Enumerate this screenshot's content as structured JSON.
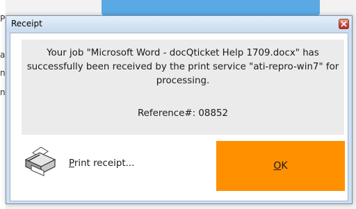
{
  "window": {
    "title": "Receipt"
  },
  "message": {
    "body": "Your job \"Microsoft Word - docQticket Help 1709.docx\" has successfully been received by the print service \"ati-repro-win7\" for processing.",
    "reference_label": "Reference#:",
    "reference_number": "08852"
  },
  "actions": {
    "print_receipt_mnemonic": "P",
    "print_receipt_rest": "rint receipt...",
    "ok_mnemonic": "O",
    "ok_rest": "K"
  },
  "background": {
    "left_chars": [
      "P",
      "a",
      "n",
      "n"
    ]
  },
  "icons": {
    "printer": "printer-icon",
    "close": "close-icon"
  },
  "colors": {
    "ok_button": "#ff9000",
    "message_panel": "#ebebeb",
    "close_button": "#c94a3a"
  }
}
